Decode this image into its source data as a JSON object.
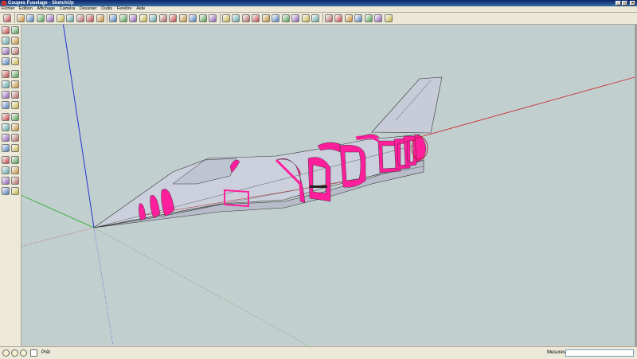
{
  "window": {
    "title": "Coupes Fuselage - SketchUp",
    "controls": [
      "minimize-icon",
      "maximize-icon",
      "close-icon"
    ]
  },
  "menubar": {
    "items": [
      {
        "label": "Fichier"
      },
      {
        "label": "Edition"
      },
      {
        "label": "Affichage"
      },
      {
        "label": "Caméra"
      },
      {
        "label": "Dessiner"
      },
      {
        "label": "Outils"
      },
      {
        "label": "Fenêtre"
      },
      {
        "label": "Aide"
      }
    ]
  },
  "toolbar": {
    "icons": [
      "select-icon",
      "pencil-icon",
      "rectangle-icon",
      "circle-icon",
      "arc-icon",
      "polygon-icon",
      "freehand-icon",
      "eraser-icon",
      "paint-bucket-icon",
      "push-pull-icon",
      "move-icon",
      "rotate-icon",
      "follow-me-icon",
      "scale-icon",
      "offset-icon",
      "tape-measure-icon",
      "dimension-icon",
      "protractor-icon",
      "text-icon",
      "axes-icon",
      "3d-text-icon",
      "orbit-icon",
      "pan-icon",
      "zoom-icon",
      "zoom-window-icon",
      "zoom-extents-icon",
      "previous-view-icon",
      "next-view-icon",
      "position-camera-icon",
      "walk-icon",
      "look-around-icon",
      "section-plane-icon",
      "iso-view-icon",
      "top-view-icon",
      "front-view-icon",
      "right-view-icon",
      "back-view-icon",
      "left-view-icon"
    ]
  },
  "status": {
    "text": "Prêt",
    "measure_label": "Mesures",
    "measure_value": ""
  },
  "colors": {
    "viewport_bg": "#c1cfcf",
    "section_faces": "#ff1e9c",
    "axis_red": "#cc2222",
    "axis_green": "#22aa22",
    "axis_blue": "#2222cc",
    "model_faces": "#c8ccd8"
  }
}
